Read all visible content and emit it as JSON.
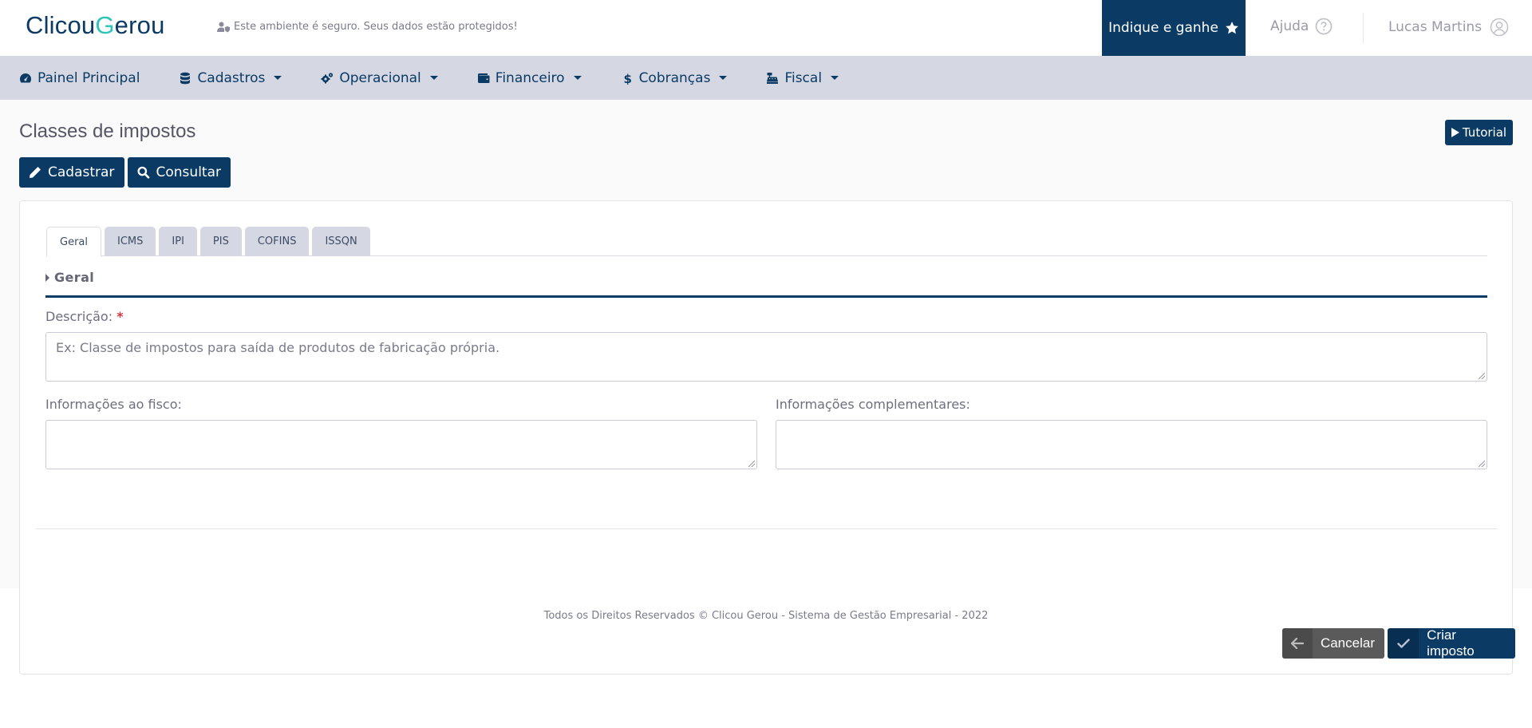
{
  "header": {
    "logo_part1": "Clicou",
    "logo_part2": "G",
    "logo_part3": "erou",
    "secure_text": "Este ambiente é seguro. Seus dados estão protegidos!",
    "indique_label": "Indique e ganhe",
    "help_label": "Ajuda",
    "user_name": "Lucas Martins",
    "accent_color": "#0b3b64"
  },
  "nav": {
    "items": [
      {
        "label": "Painel Principal",
        "icon": "gauge-icon",
        "dropdown": false
      },
      {
        "label": "Cadastros",
        "icon": "database-icon",
        "dropdown": true
      },
      {
        "label": "Operacional",
        "icon": "gears-icon",
        "dropdown": true
      },
      {
        "label": "Financeiro",
        "icon": "wallet-icon",
        "dropdown": true
      },
      {
        "label": "Cobranças",
        "icon": "dollar-icon",
        "dropdown": true
      },
      {
        "label": "Fiscal",
        "icon": "cash-register-icon",
        "dropdown": true
      }
    ]
  },
  "page": {
    "title": "Classes de impostos",
    "tutorial_label": "Tutorial",
    "register_label": "Cadastrar",
    "search_label": "Consultar"
  },
  "tabs": [
    {
      "label": "Geral",
      "active": true
    },
    {
      "label": "ICMS",
      "active": false
    },
    {
      "label": "IPI",
      "active": false
    },
    {
      "label": "PIS",
      "active": false
    },
    {
      "label": "COFINS",
      "active": false
    },
    {
      "label": "ISSQN",
      "active": false
    }
  ],
  "form": {
    "section_title": "Geral",
    "description_label": "Descrição:",
    "required_mark": "*",
    "description_placeholder": "Ex: Classe de impostos para saída de produtos de fabricação própria.",
    "fiscal_info_label": "Informações ao fisco:",
    "complementary_info_label": "Informações complementares:",
    "cancel_label": "Cancelar",
    "create_label": "Criar imposto"
  },
  "footer": {
    "text": "Todos os Direitos Reservados © Clicou Gerou - Sistema de Gestão Empresarial - 2022"
  }
}
